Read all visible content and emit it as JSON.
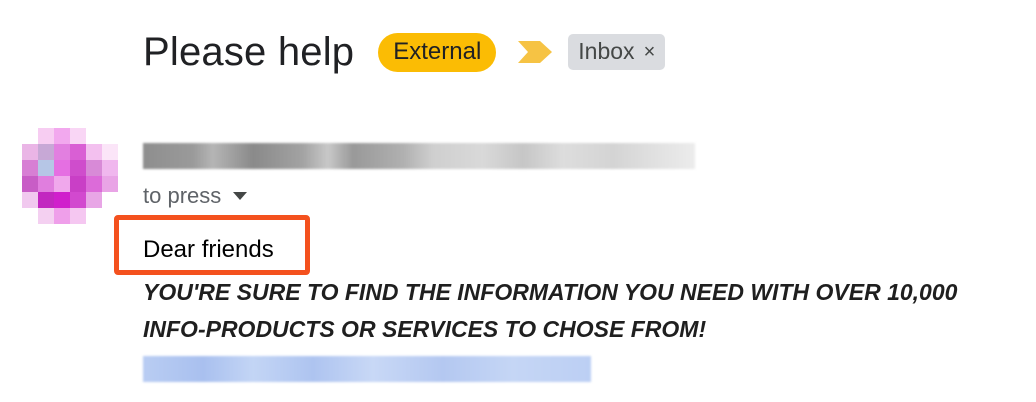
{
  "email": {
    "subject": "Please help",
    "badges": {
      "external": "External",
      "inbox": "Inbox",
      "inbox_remove": "×"
    },
    "recipient": "to press",
    "greeting": "Dear friends",
    "body_text": "YOU'RE SURE TO FIND THE INFORMATION YOU NEED WITH OVER 10,000 INFO-PRODUCTS OR SERVICES TO CHOSE FROM!"
  },
  "icons": {
    "importance": "importance-marker-icon",
    "recipient_details": "caret-down-icon",
    "remove_label": "close-icon"
  },
  "colors": {
    "external_badge": "#fbbc04",
    "importance_marker": "#f6c344",
    "label_bg": "#dadce0",
    "highlight_border": "#f4511e"
  }
}
